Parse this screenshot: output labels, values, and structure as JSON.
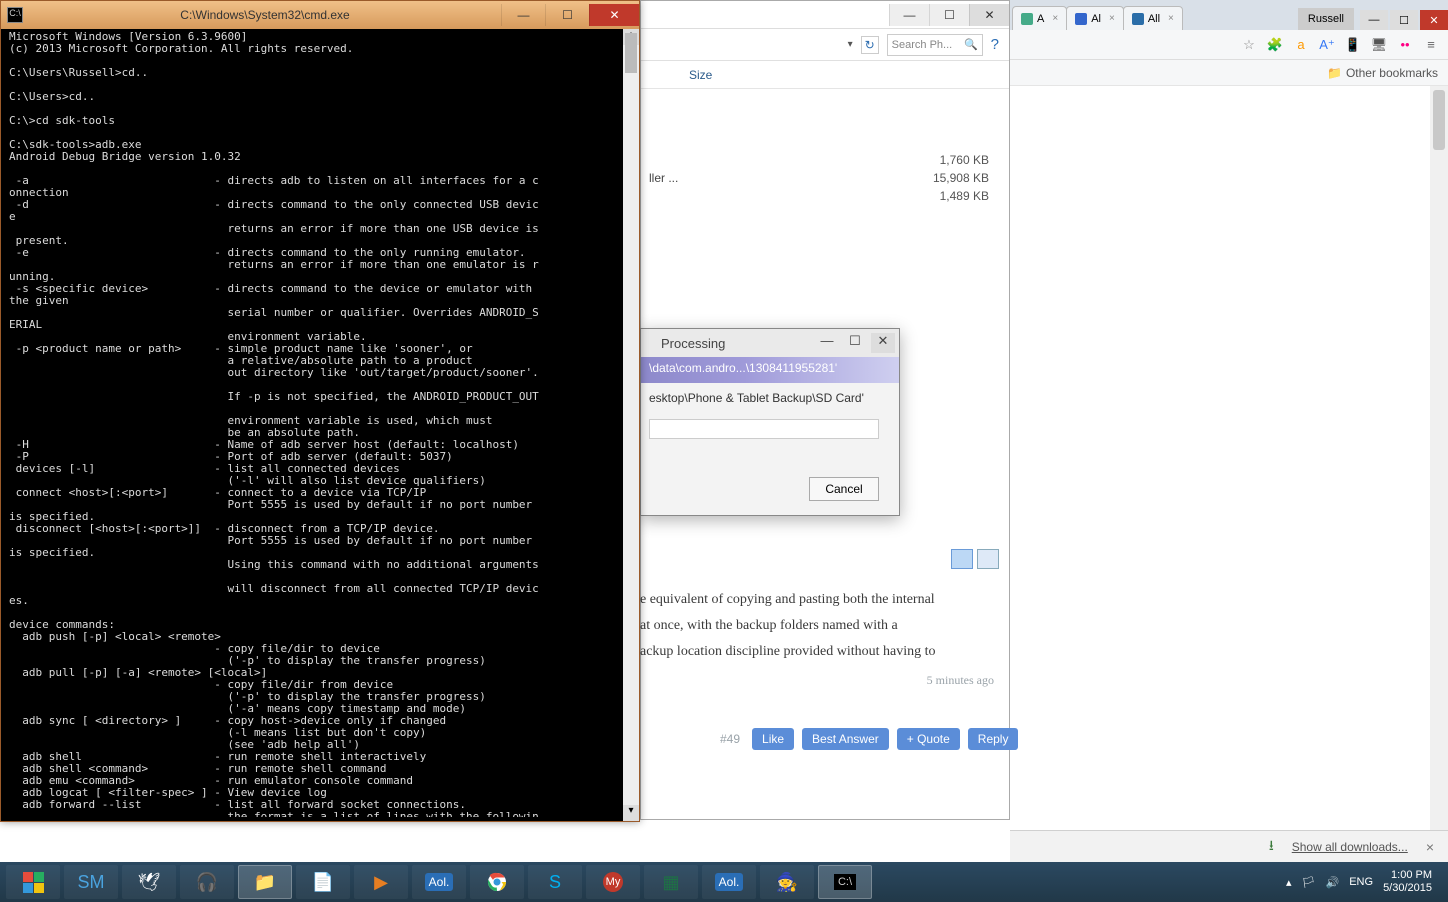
{
  "cmd": {
    "title": "C:\\Windows\\System32\\cmd.exe",
    "content": "Microsoft Windows [Version 6.3.9600]\n(c) 2013 Microsoft Corporation. All rights reserved.\n\nC:\\Users\\Russell>cd..\n\nC:\\Users>cd..\n\nC:\\>cd sdk-tools\n\nC:\\sdk-tools>adb.exe\nAndroid Debug Bridge version 1.0.32\n\n -a                            - directs adb to listen on all interfaces for a c\nonnection\n -d                            - directs command to the only connected USB devic\ne\n                                 returns an error if more than one USB device is\n present.\n -e                            - directs command to the only running emulator.\n                                 returns an error if more than one emulator is r\nunning.\n -s <specific device>          - directs command to the device or emulator with\nthe given\n                                 serial number or qualifier. Overrides ANDROID_S\nERIAL\n                                 environment variable.\n -p <product name or path>     - simple product name like 'sooner', or\n                                 a relative/absolute path to a product\n                                 out directory like 'out/target/product/sooner'.\n\n                                 If -p is not specified, the ANDROID_PRODUCT_OUT\n\n                                 environment variable is used, which must\n                                 be an absolute path.\n -H                            - Name of adb server host (default: localhost)\n -P                            - Port of adb server (default: 5037)\n devices [-l]                  - list all connected devices\n                                 ('-l' will also list device qualifiers)\n connect <host>[:<port>]       - connect to a device via TCP/IP\n                                 Port 5555 is used by default if no port number\nis specified.\n disconnect [<host>[:<port>]]  - disconnect from a TCP/IP device.\n                                 Port 5555 is used by default if no port number\nis specified.\n                                 Using this command with no additional arguments\n\n                                 will disconnect from all connected TCP/IP devic\nes.\n\ndevice commands:\n  adb push [-p] <local> <remote>\n                               - copy file/dir to device\n                                 ('-p' to display the transfer progress)\n  adb pull [-p] [-a] <remote> [<local>]\n                               - copy file/dir from device\n                                 ('-p' to display the transfer progress)\n                                 ('-a' means copy timestamp and mode)\n  adb sync [ <directory> ]     - copy host->device only if changed\n                                 (-l means list but don't copy)\n                                 (see 'adb help all')\n  adb shell                    - run remote shell interactively\n  adb shell <command>          - run remote shell command\n  adb emu <command>            - run emulator console command\n  adb logcat [ <filter-spec> ] - View device log\n  adb forward --list           - list all forward socket connections.\n                                 the format is a list of lines with the followin\ng format:\n                                    <serial> \" \" <local> \" \" <remote> \"\\n\""
  },
  "explorer": {
    "search_placeholder": "Search Ph...",
    "size_header": "Size",
    "rows": [
      {
        "name": "",
        "size": "1,760 KB"
      },
      {
        "name": "ller ...",
        "size": "15,908 KB"
      },
      {
        "name": "",
        "size": "1,489 KB"
      }
    ]
  },
  "processing": {
    "title": "Processing",
    "band": "\\data\\com.andro...\\1308411955281'",
    "path": "esktop\\Phone & Tablet Backup\\SD Card'",
    "cancel": "Cancel"
  },
  "browser": {
    "tabs": [
      {
        "label": "A"
      },
      {
        "label": "Al"
      },
      {
        "label": "All"
      }
    ],
    "profile": "Russell",
    "other_bookmarks": "Other bookmarks"
  },
  "article": {
    "line1": "e equivalent of copying and pasting both the internal",
    "line2": "at once, with the backup folders named with a",
    "line3": "ackup location discipline provided without having to",
    "timestamp": "5 minutes ago"
  },
  "forum": {
    "post_num": "#49",
    "like": "Like",
    "best": "Best Answer",
    "quote": "+ Quote",
    "reply": "Reply"
  },
  "download": {
    "show_all": "Show all downloads..."
  },
  "systray": {
    "lang": "ENG",
    "time": "1:00 PM",
    "date": "5/30/2015"
  }
}
